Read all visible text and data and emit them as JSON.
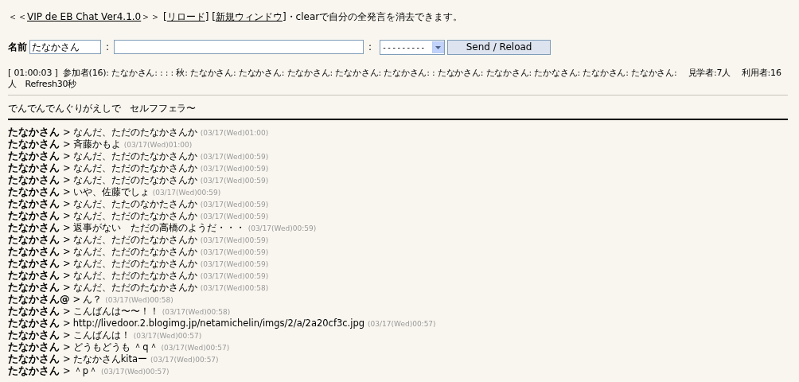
{
  "header": {
    "parts": [
      {
        "kind": "text",
        "text": "＜＜"
      },
      {
        "kind": "link",
        "text": "VIP de EB Chat Ver4.1.0"
      },
      {
        "kind": "text",
        "text": "＞＞ ["
      },
      {
        "kind": "link",
        "text": "リロード"
      },
      {
        "kind": "text",
        "text": "] ["
      },
      {
        "kind": "link",
        "text": "新規ウィンドウ"
      },
      {
        "kind": "text",
        "text": "]・clearで自分の全発言を消去できます。"
      }
    ]
  },
  "form": {
    "name_label": "名前",
    "name_value": "たなかさん",
    "separator_1": ":",
    "separator_2": ":",
    "select_value": "---------",
    "button": "Send / Reload"
  },
  "status": "[ 01:00:03 ]  参加者(16): たなかさん: : : : 秋: たなかさん: たなかさん: たなかさん: たなかさん: たなかさん: : たなかさん: たなかさん: たかなさん: たなかさん: たなかさん:　 見学者:7人　 利用者:16人　Refresh30秒",
  "topic": "でんでんでんぐりがえしで　セルフフェラ〜",
  "messages": [
    {
      "name": "たなかさん",
      "separator": ">",
      "text": "なんだ、ただのたなかさんか",
      "time": "(03/17(Wed)01:00)"
    },
    {
      "name": "たなかさん",
      "separator": ">",
      "text": "斉藤かもよ",
      "time": "(03/17(Wed)01:00)"
    },
    {
      "name": "たなかさん",
      "separator": ">",
      "text": "なんだ、ただのたなかさんか",
      "time": "(03/17(Wed)00:59)"
    },
    {
      "name": "たなかさん",
      "separator": ">",
      "text": "なんだ、ただのたなかさんか",
      "time": "(03/17(Wed)00:59)"
    },
    {
      "name": "たなかさん",
      "separator": ">",
      "text": "なんだ、ただのたなかさんか",
      "time": "(03/17(Wed)00:59)"
    },
    {
      "name": "たなかさん",
      "separator": ">",
      "text": "いや、佐藤でしょ",
      "time": "(03/17(Wed)00:59)"
    },
    {
      "name": "たなかさん",
      "separator": ">",
      "text": "なんだ、たたのなかたさんか",
      "time": "(03/17(Wed)00:59)"
    },
    {
      "name": "たなかさん",
      "separator": ">",
      "text": "なんだ、ただのたなかさんか",
      "time": "(03/17(Wed)00:59)"
    },
    {
      "name": "たなかさん",
      "separator": ">",
      "text": "返事がない　ただの高橋のようだ・・・",
      "time": "(03/17(Wed)00:59)"
    },
    {
      "name": "たなかさん",
      "separator": ">",
      "text": "なんだ、ただのたなかさんか",
      "time": "(03/17(Wed)00:59)"
    },
    {
      "name": "たなかさん",
      "separator": ">",
      "text": "なんだ、ただのたなかさんか",
      "time": "(03/17(Wed)00:59)"
    },
    {
      "name": "たなかさん",
      "separator": ">",
      "text": "なんだ、ただのたなかさんか",
      "time": "(03/17(Wed)00:59)"
    },
    {
      "name": "たなかさん",
      "separator": ">",
      "text": "なんだ、ただのたなかさんか",
      "time": "(03/17(Wed)00:59)"
    },
    {
      "name": "たなかさん",
      "separator": ">",
      "text": "なんだ、ただのたなかさんか",
      "time": "(03/17(Wed)00:58)"
    },
    {
      "name": "たなかさん@",
      "separator": ">",
      "text": "ん？",
      "time": "(03/17(Wed)00:58)"
    },
    {
      "name": "たなかさん",
      "separator": ">",
      "text": "こんばんは〜〜！！",
      "time": "(03/17(Wed)00:58)"
    },
    {
      "name": "たなかさん",
      "separator": ">",
      "text": "http://livedoor.2.blogimg.jp/netamichelin/imgs/2/a/2a20cf3c.jpg",
      "time": "(03/17(Wed)00:57)"
    },
    {
      "name": "たなかさん",
      "separator": ">",
      "text": "こんばんは！",
      "time": "(03/17(Wed)00:57)"
    },
    {
      "name": "たなかさん",
      "separator": ">",
      "text": "どうもどうも ＾q＾",
      "time": "(03/17(Wed)00:57)"
    },
    {
      "name": "たなかさん",
      "separator": ">",
      "text": "たなかさんkitaー",
      "time": "(03/17(Wed)00:57)"
    },
    {
      "name": "たなかさん",
      "separator": ">",
      "text": "＾p＾",
      "time": "(03/17(Wed)00:57)"
    }
  ]
}
